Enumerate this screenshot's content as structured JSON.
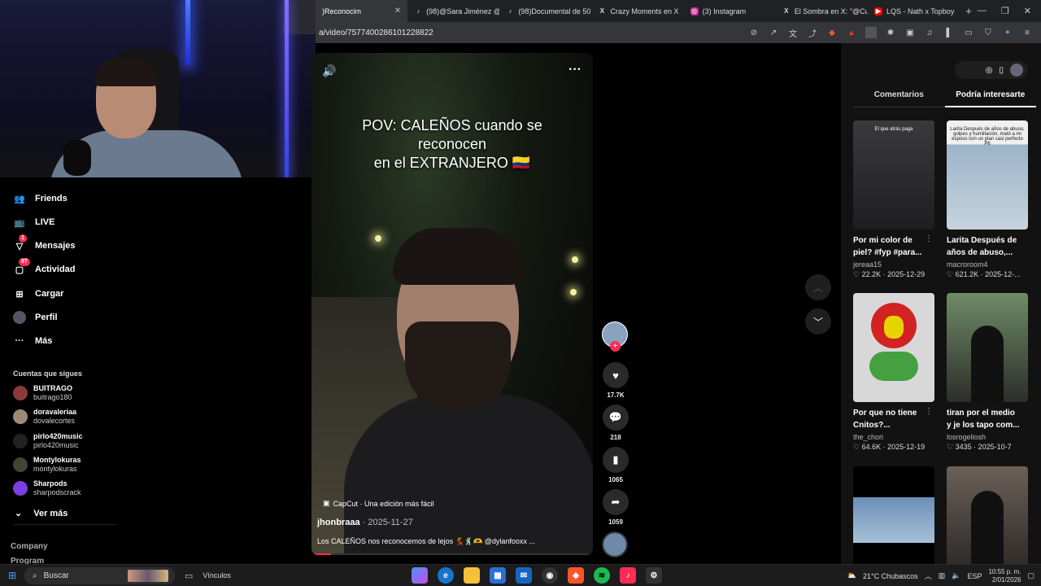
{
  "browser": {
    "tabs": [
      {
        "label": ")Reconocim",
        "icon": "tiktok-icon",
        "active": true
      },
      {
        "label": "(98)@Sara Jiménez @",
        "icon": "tiktok-icon"
      },
      {
        "label": "(98)Documental de 50",
        "icon": "tiktok-icon"
      },
      {
        "label": "Crazy Moments en X",
        "icon": "x-icon"
      },
      {
        "label": "(3) Instagram",
        "icon": "instagram-icon"
      },
      {
        "label": "El Sombra en X: \"@Cu",
        "icon": "x-icon"
      },
      {
        "label": "LQS - Nath x Topboy",
        "icon": "youtube-icon"
      }
    ],
    "url": "a/video/7577400286101228822"
  },
  "sidebar": {
    "nav": [
      {
        "label": "Friends",
        "icon": "friends-icon"
      },
      {
        "label": "LIVE",
        "icon": "live-icon"
      },
      {
        "label": "Mensajes",
        "icon": "messages-icon",
        "badge": "1"
      },
      {
        "label": "Actividad",
        "icon": "activity-icon",
        "badge": "97"
      },
      {
        "label": "Cargar",
        "icon": "upload-icon"
      },
      {
        "label": "Perfil",
        "icon": "profile-icon"
      },
      {
        "label": "Más",
        "icon": "more-icon"
      }
    ],
    "following_title": "Cuentas que sigues",
    "accounts": [
      {
        "name": "BUITRAGO",
        "handle": "buitrago180"
      },
      {
        "name": "doravaleriaa",
        "handle": "dovalecortes"
      },
      {
        "name": "pirlo420music",
        "handle": "pirlo420music"
      },
      {
        "name": "Montylokuras",
        "handle": "montylokuras"
      },
      {
        "name": "Sharpods",
        "handle": "sharpodscrack"
      }
    ],
    "see_more": "Ver más",
    "footer": [
      "Company",
      "Program"
    ]
  },
  "video": {
    "overlay_lines": [
      "POV: CALEÑOS cuando se",
      "reconocen",
      "en el EXTRANJERO 🇨🇴"
    ],
    "capcut": "CapCut · Una edición más fácil",
    "author": "jhonbraaa",
    "date": "· 2025-11-27",
    "description": "Los CALEÑOS nos reconocemos de lejos 💃🕺🫶 @dylanfooxx ...",
    "progress": 0.07
  },
  "actions": {
    "likes": "17.7K",
    "comments": "218",
    "saves": "1065",
    "shares": "1059"
  },
  "right_panel": {
    "tabs": [
      "Comentarios",
      "Podría interesarte"
    ],
    "cards": [
      {
        "title": "Por mi color de piel? #fyp #para...",
        "user": "jereaa15",
        "likes": "22.2K",
        "date": "2025-12-29",
        "caption": "El que atrás paga",
        "color": "#3a3a3c"
      },
      {
        "title": "Larita Después de años de abuso,...",
        "user": "macroroom4",
        "likes": "621.2K",
        "date": "2025-12-...",
        "caption": "Larita Después de años de abuso, golpes y humillación, mató a mi esposo con un plan casi perfecto P6",
        "color": "#9cb4c8"
      },
      {
        "title": "Por que no tiene Cnitos?...",
        "user": "the_chori",
        "likes": "64.6K",
        "date": "2025-12-19",
        "caption": "",
        "color": "#c8c8c8"
      },
      {
        "title": "tiran por el medio y je los tapo com...",
        "user": "losrogeliosh",
        "likes": "3435",
        "date": "2025-10-7",
        "caption": "",
        "color": "#6e8c66"
      },
      {
        "title": "",
        "user": "",
        "likes": "",
        "date": "",
        "caption": "",
        "color": "#6a8fb8"
      },
      {
        "title": "",
        "user": "",
        "likes": "",
        "date": "",
        "caption": "",
        "color": "#4a4540"
      }
    ]
  },
  "taskbar": {
    "search": "Buscar",
    "links": "Vínculos",
    "weather": "21°C Chubascos",
    "lang": "ESP",
    "time": "10:55 p. m.",
    "date": "2/01/2026"
  },
  "colors": {
    "accent": "#fe2c55",
    "bg": "#000000",
    "panel": "#121212"
  }
}
